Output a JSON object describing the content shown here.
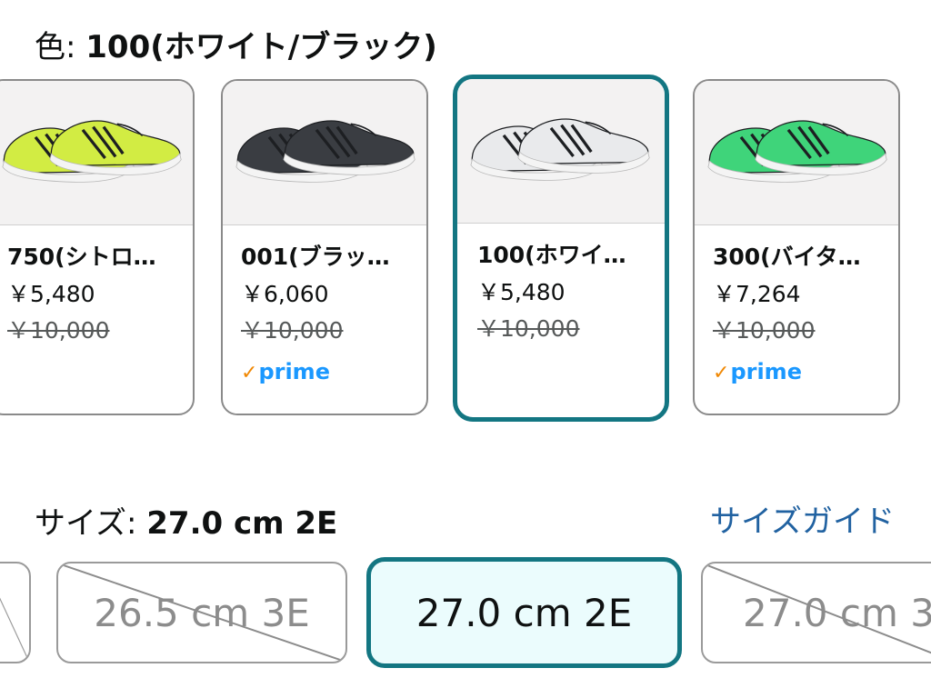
{
  "color_section": {
    "label": "色: ",
    "value": "100(ホワイト/ブラック)",
    "options": [
      {
        "name": "750(シトロ…",
        "price": "￥5,480",
        "list_price": "￥10,000",
        "badge": "",
        "shoe_color": "#d2ec43",
        "selected": false
      },
      {
        "name": "001(ブラッ…",
        "price": "￥6,060",
        "list_price": "￥10,000",
        "badge": "prime",
        "shoe_color": "#3a3d42",
        "selected": false
      },
      {
        "name": "100(ホワイ…",
        "price": "￥5,480",
        "list_price": "￥10,000",
        "badge": "",
        "shoe_color": "#e9eaec",
        "selected": true
      },
      {
        "name": "300(バイタ…",
        "price": "￥7,264",
        "list_price": "￥10,000",
        "badge": "prime",
        "shoe_color": "#3fd47a",
        "selected": false
      }
    ]
  },
  "size_section": {
    "label": "サイズ: ",
    "value": "27.0 cm 2E",
    "guide_link": "サイズガイド",
    "options": [
      {
        "label": "",
        "available": false,
        "selected": false
      },
      {
        "label": "26.5 cm 3E",
        "available": false,
        "selected": false
      },
      {
        "label": "27.0 cm 2E",
        "available": true,
        "selected": true
      },
      {
        "label": "27.0 cm 3",
        "available": false,
        "selected": false
      }
    ]
  },
  "prime_badge": {
    "check": "✓",
    "text": "prime"
  },
  "colors": {
    "selected_border": "#137682",
    "selected_bg": "#ebfcfd",
    "link": "#2162a1",
    "prime": "#1a98ff"
  }
}
